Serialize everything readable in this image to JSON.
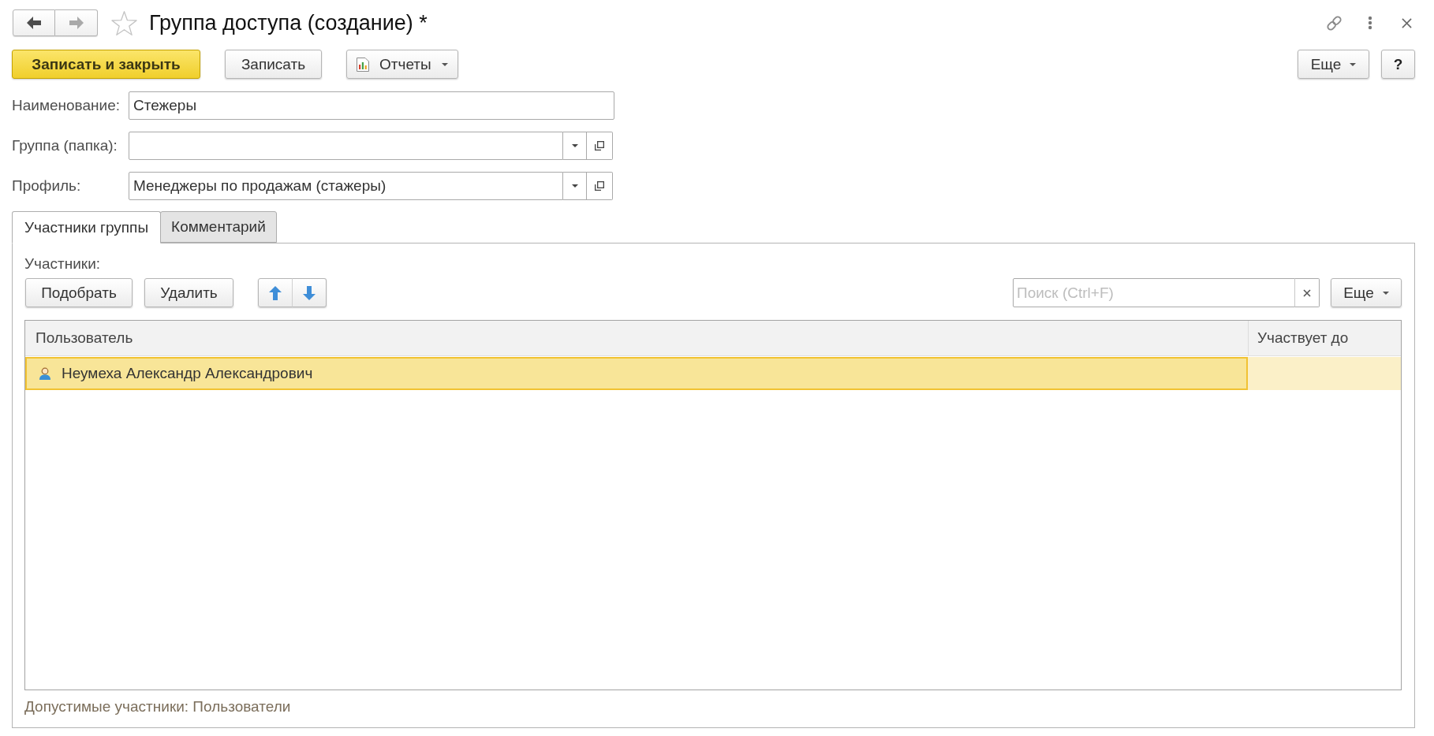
{
  "window": {
    "title": "Группа доступа (создание) *",
    "starred": false
  },
  "nav": [
    {
      "kind": "back",
      "disabled": false
    },
    {
      "kind": "forward",
      "disabled": true
    }
  ],
  "command_bar": {
    "buttons": [
      {
        "label": "Записать и закрыть",
        "kind": "default"
      },
      {
        "label": "Записать",
        "kind": "plain"
      },
      {
        "label": "Отчеты",
        "kind": "report_menu"
      }
    ],
    "right_buttons": [
      {
        "label": "Еще",
        "kind": "menu"
      },
      {
        "label": "?",
        "kind": "help"
      }
    ]
  },
  "fields": [
    {
      "label": "Наименование:",
      "kind": "text",
      "value": "Стежеры"
    },
    {
      "label": "Группа (папка):",
      "kind": "choice"
    },
    {
      "label": "Профиль:",
      "kind": "choice",
      "value": "Менеджеры по продажам (стажеры)"
    }
  ],
  "tabs": [
    {
      "label": "Участники группы",
      "selected": true
    },
    {
      "label": "Комментарий",
      "selected": false
    }
  ],
  "members": {
    "label": "Участники:",
    "buttons": [
      {
        "label": "Подобрать"
      },
      {
        "label": "Удалить"
      }
    ],
    "search": {
      "placeholder": "Поиск (Ctrl+F)"
    },
    "more_button": {
      "label": "Еще"
    },
    "table": {
      "columns": [
        "Пользователь",
        "Участвует до"
      ],
      "rows": [
        {
          "user": "Неумеха Александр Александрович",
          "selected": true
        }
      ]
    },
    "footer": "Допустимые участники: Пользователи"
  }
}
